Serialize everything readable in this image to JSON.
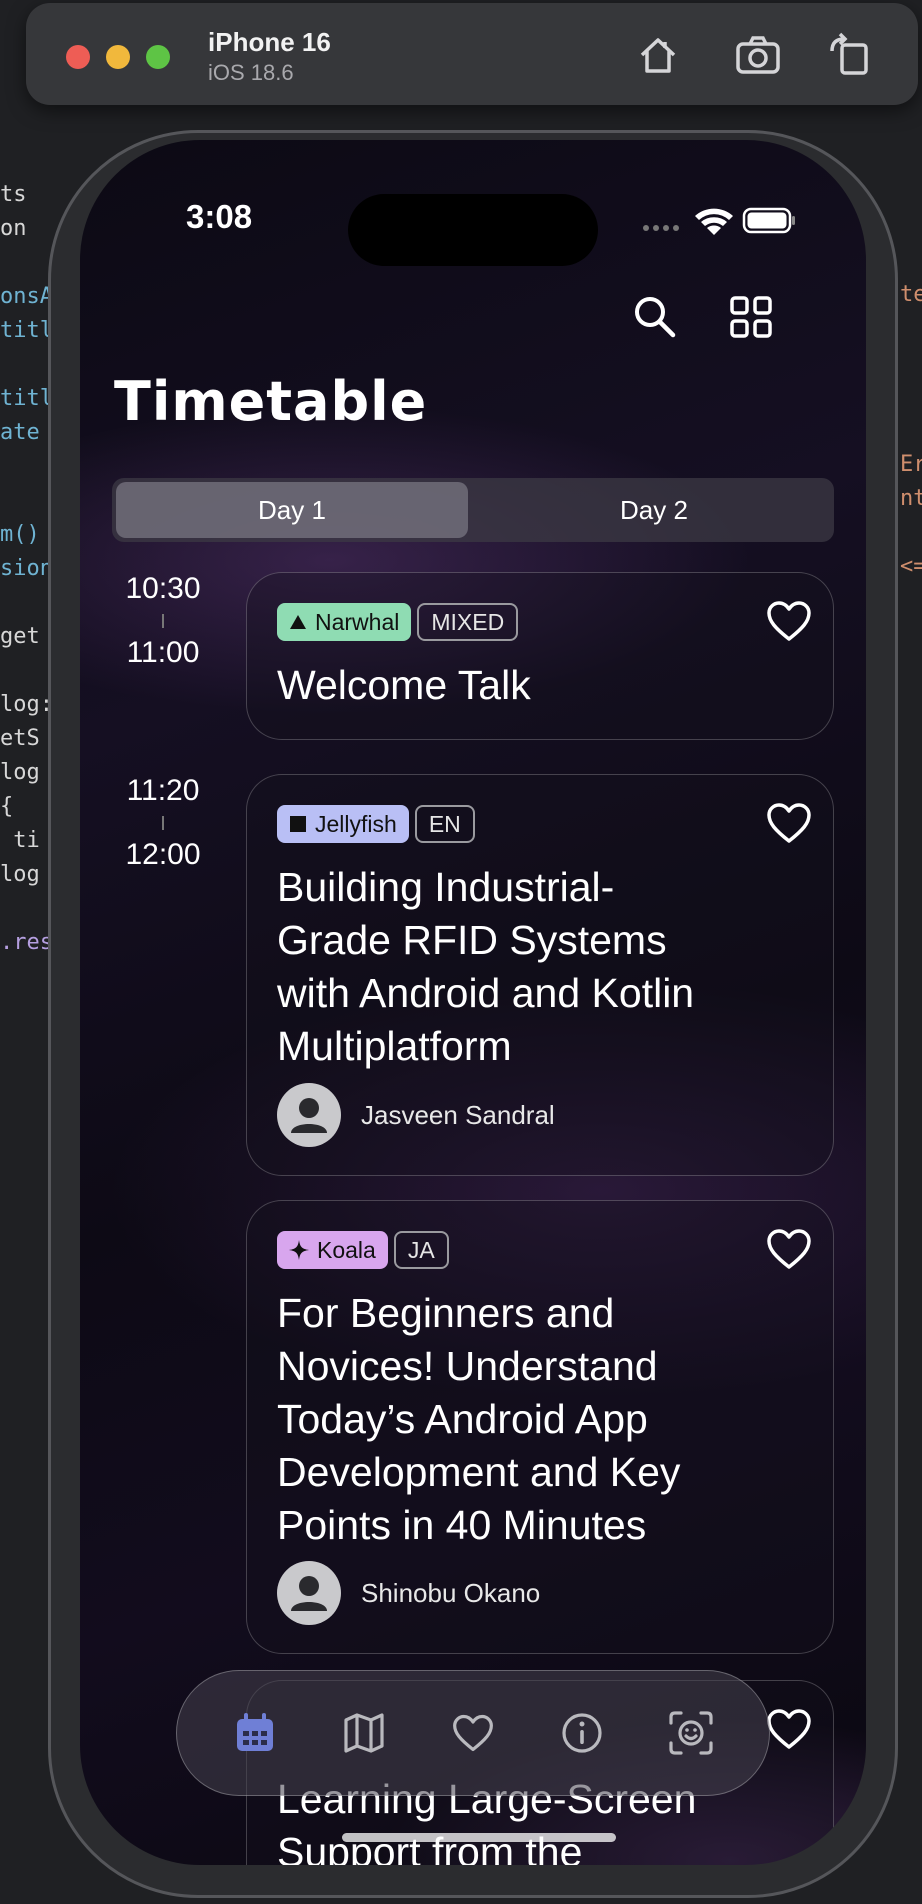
{
  "simulator": {
    "device_name": "iPhone 16",
    "os_version": "iOS 18.6",
    "window_controls": [
      "close",
      "minimize",
      "zoom"
    ],
    "buttons": [
      "home-icon",
      "screenshot-icon",
      "rotate-icon"
    ]
  },
  "background_editor": {
    "left_fragments": [
      "ts",
      "on",
      "",
      "onsA",
      "titl",
      "",
      "titl",
      "ate",
      "",
      "",
      "m()",
      "sion",
      "",
      "get",
      "",
      "log:",
      "etS",
      "log",
      "{",
      " ti",
      "log",
      "",
      ".res"
    ],
    "right_fragments": [
      "te",
      "",
      "",
      "",
      "",
      "Er",
      "nt",
      "",
      "<="
    ]
  },
  "status_bar": {
    "time": "3:08"
  },
  "header": {
    "title": "Timetable",
    "search_icon": "search-icon",
    "grid_icon": "grid-view-icon"
  },
  "day_tabs": [
    {
      "label": "Day 1",
      "selected": true
    },
    {
      "label": "Day 2",
      "selected": false
    }
  ],
  "slots": [
    {
      "start": "10:30",
      "end": "11:00"
    },
    {
      "start": "11:20",
      "end": "12:00"
    }
  ],
  "sessions": [
    {
      "room": "Narwhal",
      "room_icon": "triangle-icon",
      "room_color": "#8fdcb3",
      "language": "MIXED",
      "title_lines": [
        "Welcome Talk"
      ],
      "speaker": ""
    },
    {
      "room": "Jellyfish",
      "room_icon": "square-icon",
      "room_color": "#b9bff5",
      "language": "EN",
      "title_lines": [
        "Building Industrial-",
        "Grade RFID Systems",
        "with Android and Kotlin",
        "Multiplatform"
      ],
      "speaker": "Jasveen Sandral"
    },
    {
      "room": "Koala",
      "room_icon": "sparkle-icon",
      "room_color": "#d8a6ee",
      "language": "JA",
      "title_lines": [
        "For Beginners and",
        "Novices! Understand",
        "Today’s Android App",
        "Development and Key",
        "Points in 40 Minutes"
      ],
      "speaker": "Shinobu Okano"
    },
    {
      "room": "",
      "language": "",
      "title_lines": [
        "Learning Large-Screen",
        "Support from the"
      ],
      "speaker": ""
    }
  ],
  "bottom_nav": [
    {
      "icon": "calendar-icon",
      "active": true
    },
    {
      "icon": "map-icon",
      "active": false
    },
    {
      "icon": "heart-icon",
      "active": false
    },
    {
      "icon": "info-icon",
      "active": false
    },
    {
      "icon": "face-scan-icon",
      "active": false
    }
  ],
  "colors": {
    "active_tab": "#6f7fd6",
    "inactive_tab": "#b9b9be"
  }
}
